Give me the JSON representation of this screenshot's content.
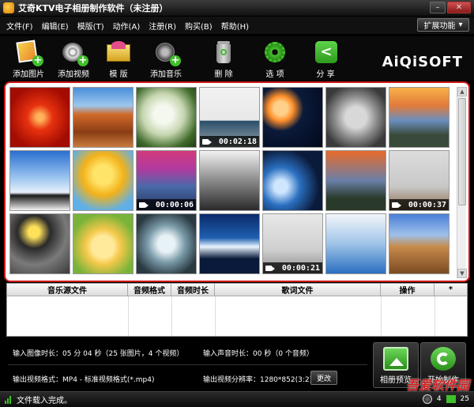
{
  "window": {
    "title": "艾奇KTV电子相册制作软件（未注册）"
  },
  "menu": [
    "文件(F)",
    "编辑(E)",
    "模版(T)",
    "动作(A)",
    "注册(R)",
    "购买(B)",
    "帮助(H)"
  ],
  "extension_button": "扩展功能",
  "toolbar": [
    {
      "label": "添加图片",
      "icon": "add-image-icon"
    },
    {
      "label": "添加视频",
      "icon": "add-video-icon"
    },
    {
      "label": "模 版",
      "icon": "template-icon"
    },
    {
      "label": "添加音乐",
      "icon": "add-music-icon"
    },
    {
      "label": "删 除",
      "icon": "delete-icon"
    },
    {
      "label": "选 项",
      "icon": "options-icon"
    },
    {
      "label": "分 享",
      "icon": "share-icon"
    }
  ],
  "logo": "AiQiSOFT",
  "media": [
    {
      "kind": "image",
      "subject": "red-flower"
    },
    {
      "kind": "image",
      "subject": "desert"
    },
    {
      "kind": "image",
      "subject": "hydrangea"
    },
    {
      "kind": "video",
      "subject": "presenter",
      "duration": "00:02:18"
    },
    {
      "kind": "image",
      "subject": "jellyfish"
    },
    {
      "kind": "image",
      "subject": "koala"
    },
    {
      "kind": "image",
      "subject": "lighthouse"
    },
    {
      "kind": "image",
      "subject": "penguins"
    },
    {
      "kind": "image",
      "subject": "tulips"
    },
    {
      "kind": "video",
      "subject": "ping-pong",
      "duration": "00:00:06"
    },
    {
      "kind": "image",
      "subject": "eiffel"
    },
    {
      "kind": "image",
      "subject": "earth"
    },
    {
      "kind": "image",
      "subject": "stonehenge"
    },
    {
      "kind": "video",
      "subject": "room",
      "duration": "00:00:37"
    },
    {
      "kind": "image",
      "subject": "stones"
    },
    {
      "kind": "image",
      "subject": "duckling"
    },
    {
      "kind": "image",
      "subject": "ferris-wheel"
    },
    {
      "kind": "image",
      "subject": "opera-house"
    },
    {
      "kind": "video",
      "subject": "office",
      "duration": "00:00:21"
    },
    {
      "kind": "image",
      "subject": "eiffel-blue"
    },
    {
      "kind": "image",
      "subject": "colosseum"
    }
  ],
  "music_table": {
    "headers": [
      "音乐源文件",
      "音频格式",
      "音频时长",
      "歌词文件",
      "操作",
      "*"
    ]
  },
  "info": {
    "input_image_duration": "输入图像时长：05 分 04 秒（25 张图片，4 个视频）",
    "input_audio_duration": "输入声音时长：00 秒（0 个音频）",
    "output_format": "输出视频格式：MP4 - 标准视频格式(*.mp4)",
    "output_resolution": "输出视频分辨率：1280*852(3:2)",
    "change_label": "更改"
  },
  "actions": {
    "preview": "相册预览",
    "start": "开始制作"
  },
  "status": {
    "text": "文件载入完成。",
    "count": "4",
    "time": "25"
  },
  "watermark": "吾爱软件园"
}
